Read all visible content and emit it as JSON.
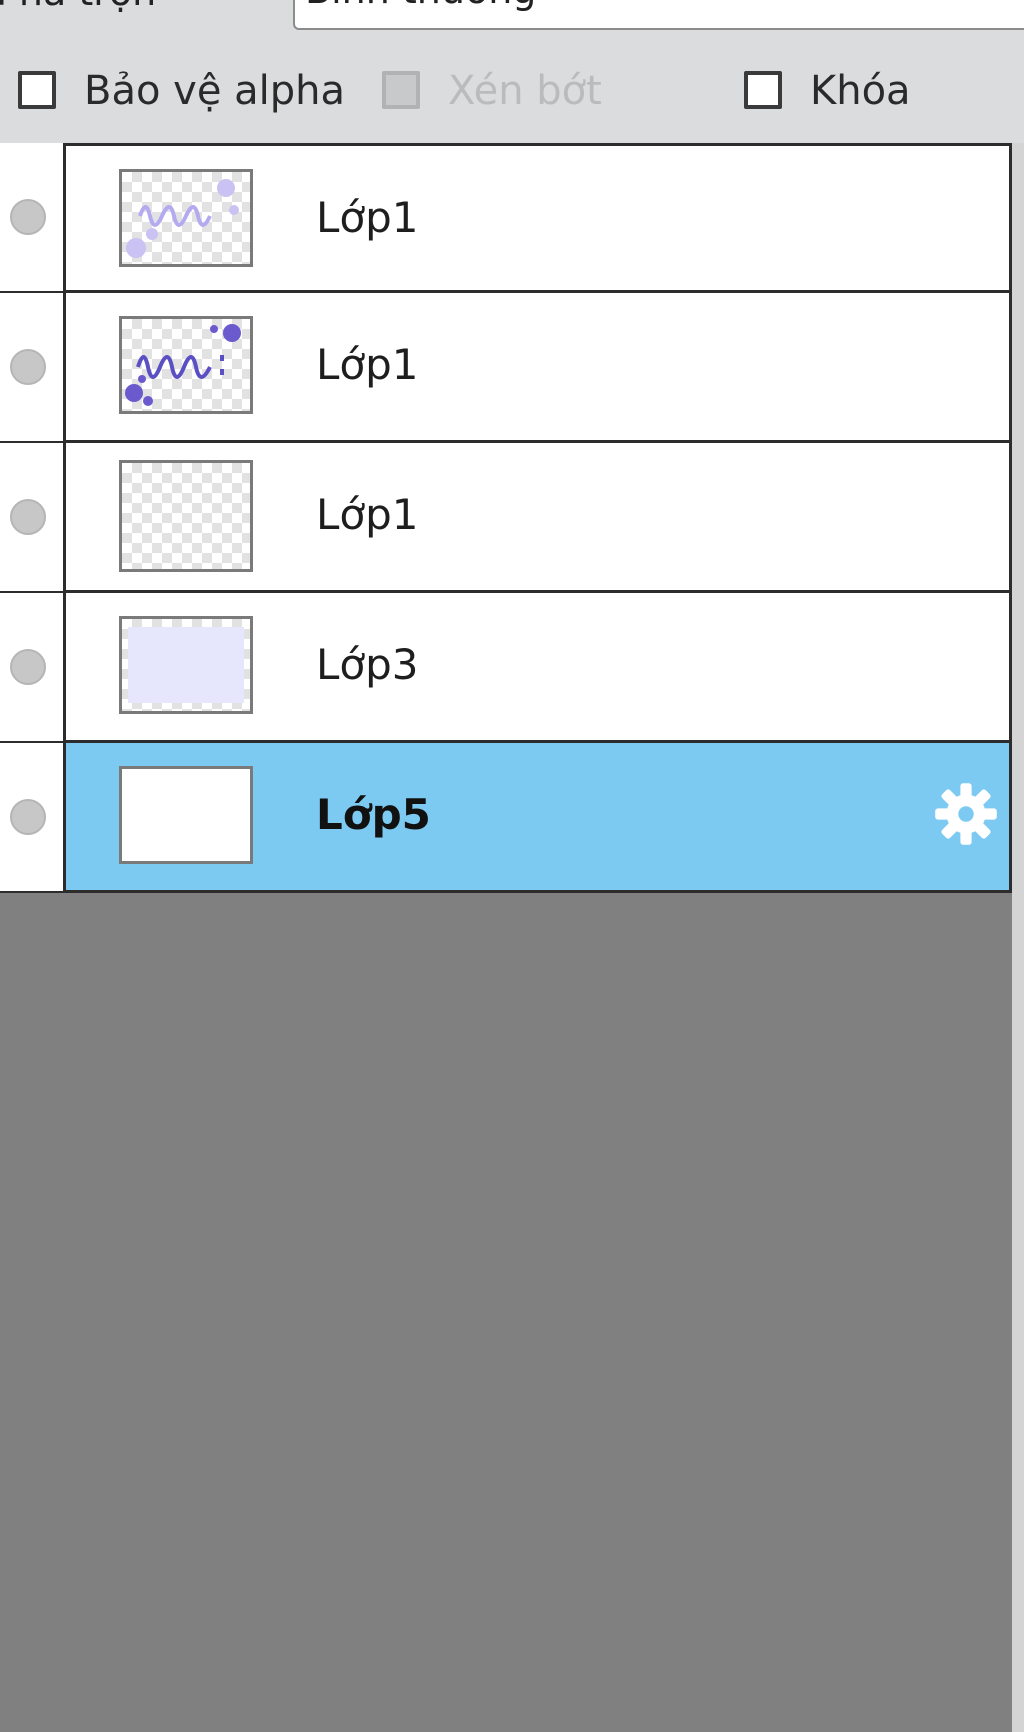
{
  "blend": {
    "label": "Pha trộn",
    "value": "Bình thường"
  },
  "options": {
    "protect_alpha": {
      "label": "Bảo vệ alpha",
      "checked": false,
      "enabled": true
    },
    "clipping": {
      "label": "Xén bớt",
      "checked": false,
      "enabled": false
    },
    "lock": {
      "label": "Khóa",
      "checked": false,
      "enabled": true
    }
  },
  "layers": [
    {
      "name": "Lớp1",
      "thumbnail": "light-purple-handwriting",
      "selected": false
    },
    {
      "name": "Lớp1",
      "thumbnail": "purple-handwriting-dots",
      "selected": false
    },
    {
      "name": "Lớp1",
      "thumbnail": "transparent",
      "selected": false
    },
    {
      "name": "Lớp3",
      "thumbnail": "lavender-fill",
      "selected": false
    },
    {
      "name": "Lớp5",
      "thumbnail": "white-fill",
      "selected": true,
      "icon": "gear-icon"
    }
  ],
  "colors": {
    "selected_row": "#7ccaf2",
    "empty_area": "#808080",
    "thumb_ink": "#6a5acd"
  }
}
